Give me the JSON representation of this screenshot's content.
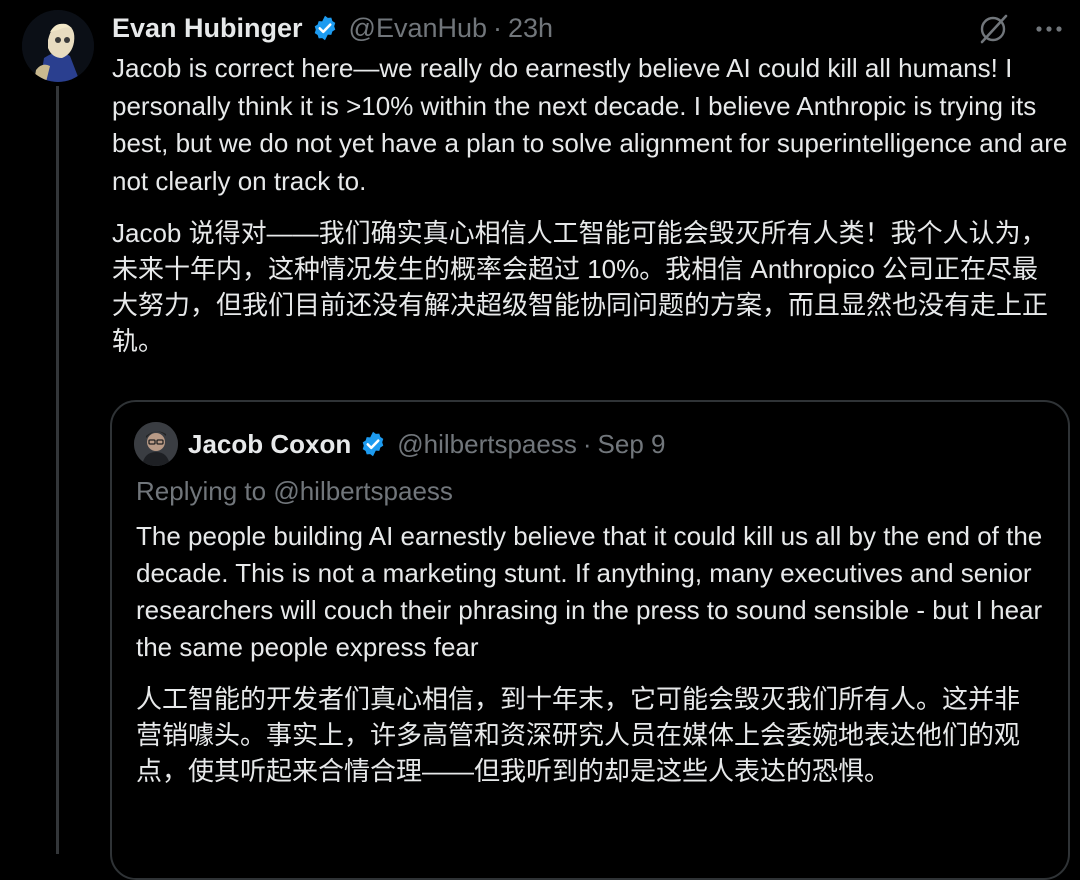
{
  "colors": {
    "background": "#000000",
    "text_primary": "#e7e9ea",
    "text_secondary": "#71767b",
    "verified_badge": "#1d9bf0",
    "border": "#2f3336"
  },
  "icons": {
    "verified": "verified-badge-icon",
    "grok": "grok-icon",
    "more": "more-options-icon"
  },
  "tweet": {
    "author": {
      "display_name": "Evan Hubinger",
      "handle": "@EvanHub"
    },
    "separator": "·",
    "time": "23h",
    "text_en": "Jacob is correct here—we really do earnestly believe AI could kill all humans! I personally think it is >10% within the next decade. I believe Anthropic is trying its best, but we do not yet have a plan to solve alignment for superintelligence and are not clearly on track to.",
    "text_zh": "Jacob 说得对——我们确实真心相信人工智能可能会毁灭所有人类！我个人认为，未来十年内，这种情况发生的概率会超过 10%。我相信 Anthropico 公司正在尽最大努力，但我们目前还没有解决超级智能协同问题的方案，而且显然也没有走上正轨。"
  },
  "quoted_tweet": {
    "author": {
      "display_name": "Jacob Coxon",
      "handle": "@hilbertspaess"
    },
    "separator": "·",
    "time": "Sep 9",
    "replying_prefix": "Replying to",
    "replying_handle": "@hilbertspaess",
    "text_en": "The people building AI earnestly believe that it could kill us all by the end of the decade. This is not a marketing stunt. If anything, many executives and senior researchers will couch their phrasing in the press to sound sensible - but I hear the same people express fear",
    "text_zh": "人工智能的开发者们真心相信，到十年末，它可能会毁灭我们所有人。这并非营销噱头。事实上，许多高管和资深研究人员在媒体上会委婉地表达他们的观点，使其听起来合情合理——但我听到的却是这些人表达的恐惧。"
  }
}
